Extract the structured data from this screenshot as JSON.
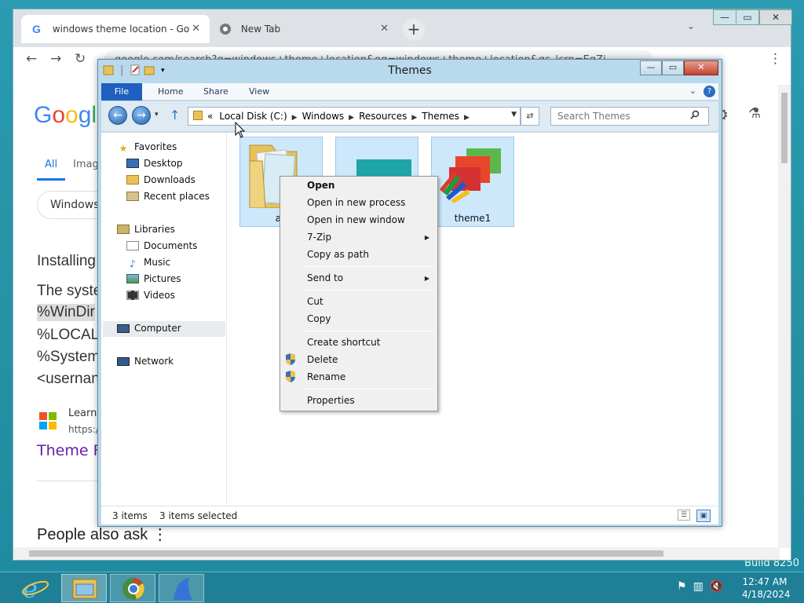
{
  "desktop": {
    "build_text": "Build 8250"
  },
  "chrome": {
    "tabs": [
      {
        "title": "windows theme location - Goog",
        "close": "✕"
      },
      {
        "title": "New Tab",
        "close": "✕"
      }
    ],
    "new_tab": "+",
    "tab_search": "⌄",
    "window_buttons": {
      "minimize": "—",
      "maximize": "▭",
      "close": "✕"
    },
    "toolbar": {
      "back": "←",
      "forward": "→",
      "reload": "↻",
      "menu": "⋮"
    },
    "omnibox_text": "google.com/search?q=windows+theme+location&oq=windows+theme+location&gs_lcrp=EgZj",
    "google": {
      "logo_letters": [
        "G",
        "o",
        "o",
        "g",
        "l",
        "e"
      ],
      "tab_all": "All",
      "tab_images": "Imag",
      "chip": "Windows",
      "lines": [
        "Installing",
        "The syste",
        "%WinDir",
        "%LOCAL",
        "%System",
        "<usernan"
      ],
      "result_source": "Learn",
      "result_url": "https://",
      "result_title": "Theme F",
      "people_also_ask": "People also ask  ⋮",
      "gear": "⚙",
      "flask": "⚗"
    }
  },
  "explorer": {
    "title": "Themes",
    "window_buttons": {
      "minimize": "—",
      "maximize": "▭",
      "close": "✕"
    },
    "ribbon": {
      "file": "File",
      "tabs": [
        "Home",
        "Share",
        "View"
      ],
      "help": "?",
      "expand": "⌄"
    },
    "nav": {
      "back": "←",
      "forward": "→",
      "recent": "▾",
      "up": "↑"
    },
    "address": {
      "overflow": "«",
      "crumbs": [
        "Local Disk (C:)",
        "Windows",
        "Resources",
        "Themes"
      ],
      "refresh": "⇄"
    },
    "search_placeholder": "Search Themes",
    "nav_pane": {
      "favorites": "Favorites",
      "favorites_items": [
        "Desktop",
        "Downloads",
        "Recent places"
      ],
      "libraries": "Libraries",
      "libraries_items": [
        "Documents",
        "Music",
        "Pictures",
        "Videos"
      ],
      "computer": "Computer",
      "network": "Network"
    },
    "items": [
      {
        "name": "ae"
      },
      {
        "name": ""
      },
      {
        "name": "theme1"
      }
    ],
    "status": {
      "count": "3 items",
      "selected": "3 items selected"
    }
  },
  "context_menu": {
    "items": [
      {
        "label": "Open",
        "bold": true
      },
      {
        "label": "Open in new process"
      },
      {
        "label": "Open in new window"
      },
      {
        "label": "7-Zip",
        "submenu": true
      },
      {
        "label": "Copy as path"
      },
      {
        "label": "Send to",
        "submenu": true
      },
      {
        "label": "Cut"
      },
      {
        "label": "Copy"
      },
      {
        "label": "Create shortcut"
      },
      {
        "label": "Delete",
        "shield": true
      },
      {
        "label": "Rename",
        "shield": true
      },
      {
        "label": "Properties"
      }
    ]
  },
  "taskbar": {
    "clock_time": "12:47 AM",
    "clock_date": "4/18/2024"
  },
  "colors": {
    "desktop_bg": "#2591a3",
    "selection_bg": "#cde8fb",
    "file_tab": "#1f5fbf"
  }
}
